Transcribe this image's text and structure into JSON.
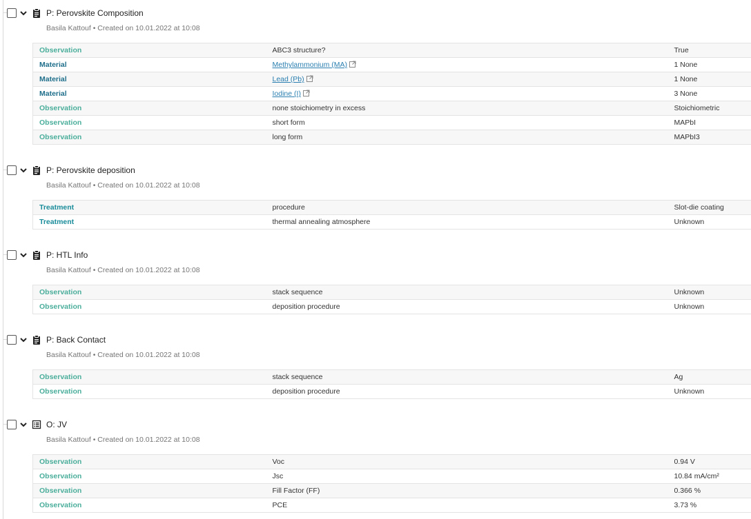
{
  "sections": [
    {
      "title": "P: Perovskite Composition",
      "meta": "Basila Kattouf • Created on 10.01.2022 at 10:08",
      "icon": "clipboard-icon",
      "rows": [
        {
          "kind": "Observation",
          "name": "ABC3 structure?",
          "value": "True"
        },
        {
          "kind": "Material",
          "name": "Methylammonium (MA)",
          "value": "1 None"
        },
        {
          "kind": "Material",
          "name": "Lead (Pb)",
          "value": "1 None"
        },
        {
          "kind": "Material",
          "name": "Iodine (I)",
          "value": "3 None"
        },
        {
          "kind": "Observation",
          "name": "none stoichiometry in excess",
          "value": "Stoichiometric"
        },
        {
          "kind": "Observation",
          "name": "short form",
          "value": "MAPbI"
        },
        {
          "kind": "Observation",
          "name": "long form",
          "value": "MAPbI3"
        }
      ]
    },
    {
      "title": "P: Perovskite deposition",
      "meta": "Basila Kattouf • Created on 10.01.2022 at 10:08",
      "icon": "clipboard-icon",
      "rows": [
        {
          "kind": "Treatment",
          "name": "procedure",
          "value": "Slot-die coating"
        },
        {
          "kind": "Treatment",
          "name": "thermal annealing atmosphere",
          "value": "Unknown"
        }
      ]
    },
    {
      "title": "P: HTL Info",
      "meta": "Basila Kattouf • Created on 10.01.2022 at 10:08",
      "icon": "clipboard-icon",
      "rows": [
        {
          "kind": "Observation",
          "name": "stack sequence",
          "value": "Unknown"
        },
        {
          "kind": "Observation",
          "name": "deposition procedure",
          "value": "Unknown"
        }
      ]
    },
    {
      "title": "P: Back Contact",
      "meta": "Basila Kattouf • Created on 10.01.2022 at 10:08",
      "icon": "clipboard-icon",
      "rows": [
        {
          "kind": "Observation",
          "name": "stack sequence",
          "value": "Ag"
        },
        {
          "kind": "Observation",
          "name": "deposition procedure",
          "value": "Unknown"
        }
      ]
    },
    {
      "title": "O: JV",
      "meta": "Basila Kattouf • Created on 10.01.2022 at 10:08",
      "icon": "list-table-icon",
      "rows": [
        {
          "kind": "Observation",
          "name": "Voc",
          "value": "0.94 V"
        },
        {
          "kind": "Observation",
          "name": "Jsc",
          "value": "10.84 mA/cm²"
        },
        {
          "kind": "Observation",
          "name": "Fill Factor (FF)",
          "value": "0.366 %"
        },
        {
          "kind": "Observation",
          "name": "PCE",
          "value": "3.73 %"
        }
      ]
    }
  ]
}
